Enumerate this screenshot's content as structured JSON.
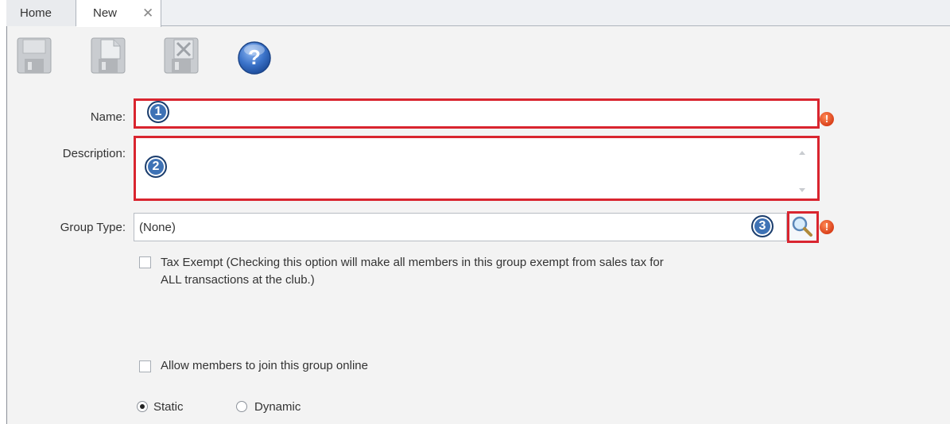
{
  "tabs": {
    "home_label": "Home",
    "new_label": "New",
    "close_glyph": "✕"
  },
  "toolbar": {
    "save_icon": "save-icon",
    "save_as_icon": "save-copy-icon",
    "delete_icon": "delete-icon",
    "help_icon": "help-icon",
    "help_glyph": "?"
  },
  "form": {
    "name": {
      "label": "Name:",
      "value": "",
      "badge": "1"
    },
    "description": {
      "label": "Description:",
      "value": "",
      "badge": "2"
    },
    "group_type": {
      "label": "Group Type:",
      "value": "(None)",
      "badge": "3"
    },
    "required_glyph": "!",
    "tax_exempt": {
      "label_line1": "Tax Exempt (Checking this option will make all members in this group exempt from sales tax for",
      "label_line2": "ALL transactions at the club.)",
      "checked": false
    },
    "allow_online": {
      "label": "Allow members to join this group online",
      "checked": false
    },
    "group_mode": {
      "options": [
        "Static",
        "Dynamic"
      ],
      "selected": "Static"
    }
  },
  "colors": {
    "highlight": "#d9252f",
    "badge": "#3e72b5",
    "required": "#d9401a"
  }
}
